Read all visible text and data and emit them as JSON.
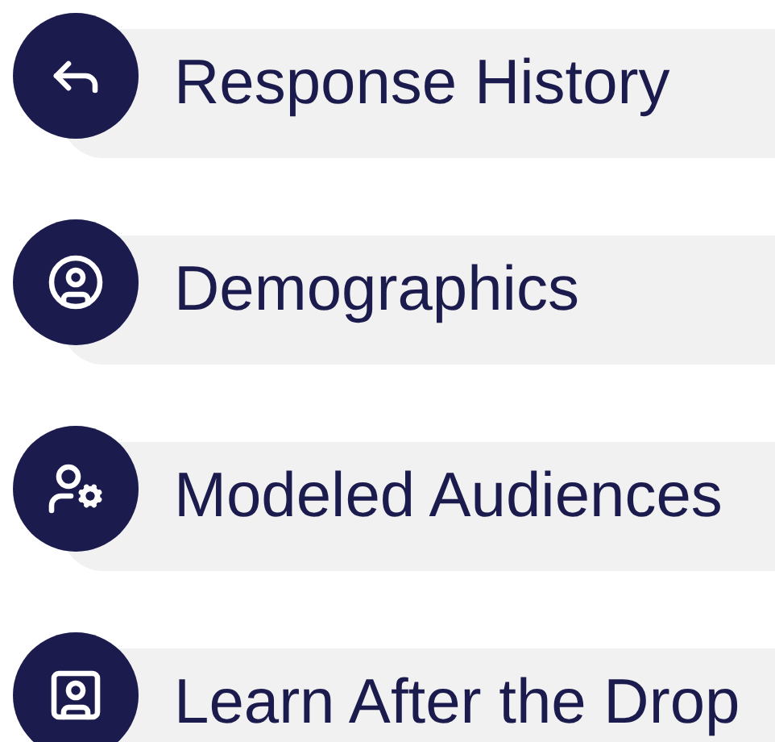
{
  "items": [
    {
      "label": "Response History"
    },
    {
      "label": "Demographics"
    },
    {
      "label": "Modeled Audiences"
    },
    {
      "label": "Learn After the Drop"
    }
  ]
}
